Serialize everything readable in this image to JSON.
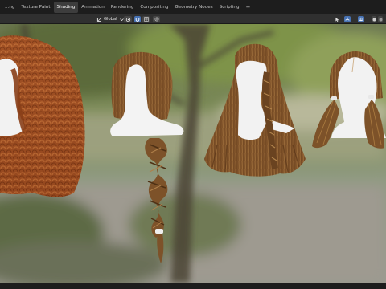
{
  "workspace_tabs": [
    {
      "label": "...ng",
      "active": false
    },
    {
      "label": "Texture Paint",
      "active": false
    },
    {
      "label": "Shading",
      "active": true
    },
    {
      "label": "Animation",
      "active": false
    },
    {
      "label": "Rendering",
      "active": false
    },
    {
      "label": "Compositing",
      "active": false
    },
    {
      "label": "Geometry Nodes",
      "active": false
    },
    {
      "label": "Scripting",
      "active": false
    }
  ],
  "add_tab_label": "+",
  "viewport_header": {
    "transform_orientation": "Global"
  },
  "viewport": {
    "background_theme": "blurred outdoor park backdrop",
    "accent_color": "#4772b3"
  },
  "hair_models": [
    {
      "style": "long-curly-ginger"
    },
    {
      "style": "single-braid"
    },
    {
      "style": "long-with-side-braids"
    },
    {
      "style": "twin-pigtails"
    }
  ]
}
